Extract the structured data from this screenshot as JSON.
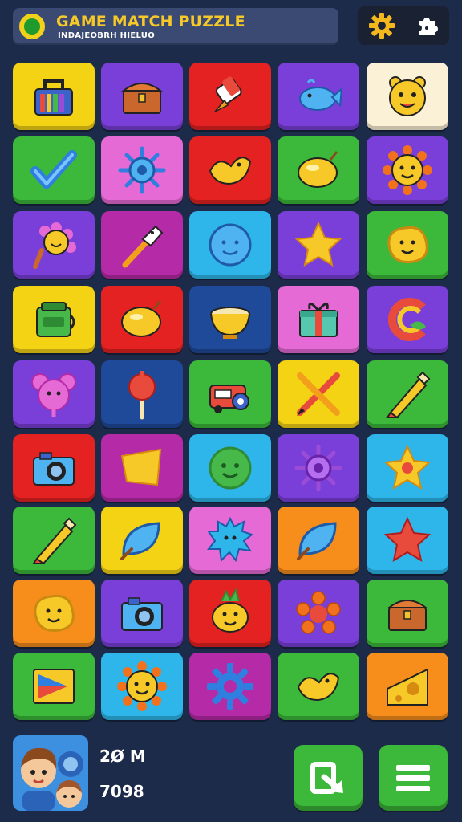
{
  "header": {
    "title": "GAME MATCH PUZZLE",
    "subtitle": "INDAJEOBRH HIELUO",
    "logo_icon": "ring-logo-icon",
    "settings_icon": "gear-icon",
    "extra_icon": "puzzle-piece-icon"
  },
  "colors": {
    "background": "#1d2b4a",
    "yellow": "#f4d315",
    "purple": "#7a3fd8",
    "red": "#e42222",
    "green": "#3cb83a",
    "cream": "#fbf1d6",
    "magenta": "#e66ad6",
    "pink": "#b52aa6",
    "cyan": "#2eb6ea",
    "navy": "#1f4a9a",
    "orange": "#f78e1c"
  },
  "tiles": [
    {
      "color": "yellow",
      "icon": "lunchbox"
    },
    {
      "color": "purple",
      "icon": "treasure-chest"
    },
    {
      "color": "red",
      "icon": "rocket"
    },
    {
      "color": "purple",
      "icon": "whale"
    },
    {
      "color": "cream",
      "icon": "bear-face"
    },
    {
      "color": "green",
      "icon": "check-mark"
    },
    {
      "color": "magenta",
      "icon": "blue-sun"
    },
    {
      "color": "red",
      "icon": "yellow-bird"
    },
    {
      "color": "green",
      "icon": "lemon"
    },
    {
      "color": "purple",
      "icon": "sun-face"
    },
    {
      "color": "purple",
      "icon": "ice-cream"
    },
    {
      "color": "pink",
      "icon": "paintbrush"
    },
    {
      "color": "cyan",
      "icon": "blue-face"
    },
    {
      "color": "purple",
      "icon": "star"
    },
    {
      "color": "green",
      "icon": "cookie-face"
    },
    {
      "color": "yellow",
      "icon": "backpack"
    },
    {
      "color": "red",
      "icon": "lemon"
    },
    {
      "color": "navy",
      "icon": "bowl"
    },
    {
      "color": "magenta",
      "icon": "gift-box"
    },
    {
      "color": "purple",
      "icon": "rainbow-c"
    },
    {
      "color": "purple",
      "icon": "mouse-face"
    },
    {
      "color": "navy",
      "icon": "lollipop"
    },
    {
      "color": "green",
      "icon": "camera-truck"
    },
    {
      "color": "yellow",
      "icon": "crossed-pencils"
    },
    {
      "color": "green",
      "icon": "pencil"
    },
    {
      "color": "red",
      "icon": "camera"
    },
    {
      "color": "pink",
      "icon": "yellow-flag"
    },
    {
      "color": "cyan",
      "icon": "green-smile"
    },
    {
      "color": "purple",
      "icon": "purple-sun"
    },
    {
      "color": "cyan",
      "icon": "flower-star"
    },
    {
      "color": "green",
      "icon": "pencil"
    },
    {
      "color": "yellow",
      "icon": "blue-leaf"
    },
    {
      "color": "magenta",
      "icon": "splat-face"
    },
    {
      "color": "orange",
      "icon": "blue-leaf"
    },
    {
      "color": "cyan",
      "icon": "red-star"
    },
    {
      "color": "orange",
      "icon": "cookie-face"
    },
    {
      "color": "purple",
      "icon": "camera"
    },
    {
      "color": "red",
      "icon": "pineapple-face"
    },
    {
      "color": "purple",
      "icon": "orange-flower"
    },
    {
      "color": "green",
      "icon": "treasure-chest"
    },
    {
      "color": "green",
      "icon": "play-triangle"
    },
    {
      "color": "cyan",
      "icon": "sun-face"
    },
    {
      "color": "pink",
      "icon": "blue-gear"
    },
    {
      "color": "green",
      "icon": "yellow-bird"
    },
    {
      "color": "orange",
      "icon": "cheese"
    }
  ],
  "footer": {
    "avatar_icon": "kids-avatar-icon",
    "stat_top": "2Ø M",
    "stat_bottom": "7098",
    "share_icon": "export-arrow-icon",
    "menu_icon": "hamburger-menu-icon"
  }
}
